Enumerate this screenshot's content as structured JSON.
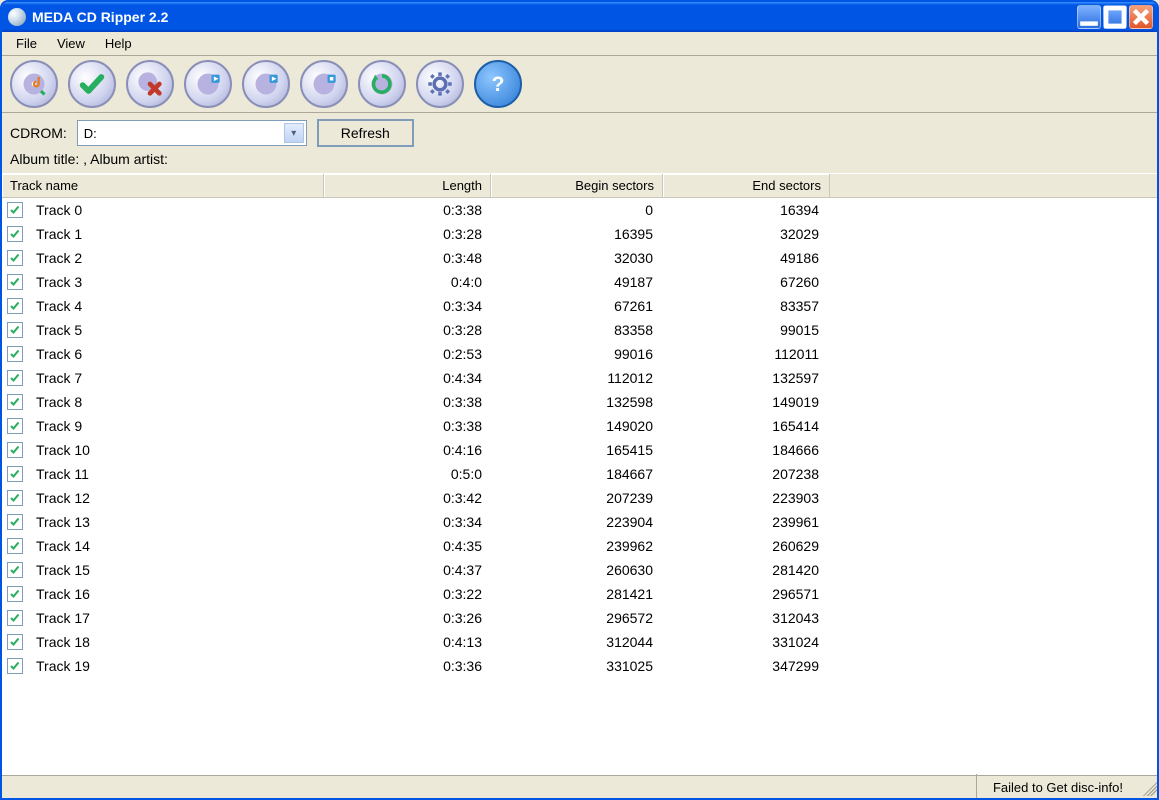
{
  "window": {
    "title": "MEDA CD Ripper 2.2"
  },
  "menubar": {
    "file": "File",
    "view": "View",
    "help": "Help"
  },
  "toolbar_icons": {
    "rip": "rip-icon",
    "check": "check-all-icon",
    "uncheck": "uncheck-icon",
    "prev": "prev-track-icon",
    "play": "play-icon",
    "stop": "stop-icon",
    "next": "next-track-icon",
    "settings": "settings-icon",
    "help": "help-icon"
  },
  "controls": {
    "cdrom_label": "CDROM:",
    "cdrom_value": "D:",
    "refresh": "Refresh"
  },
  "album": {
    "line": "Album title: , Album artist:"
  },
  "columns": {
    "name": "Track name",
    "length": "Length",
    "begin": "Begin sectors",
    "end": "End sectors"
  },
  "tracks": [
    {
      "checked": true,
      "name": "Track 0",
      "length": "0:3:38",
      "begin": "0",
      "end": "16394"
    },
    {
      "checked": true,
      "name": "Track 1",
      "length": "0:3:28",
      "begin": "16395",
      "end": "32029"
    },
    {
      "checked": true,
      "name": "Track 2",
      "length": "0:3:48",
      "begin": "32030",
      "end": "49186"
    },
    {
      "checked": true,
      "name": "Track 3",
      "length": "0:4:0",
      "begin": "49187",
      "end": "67260"
    },
    {
      "checked": true,
      "name": "Track 4",
      "length": "0:3:34",
      "begin": "67261",
      "end": "83357"
    },
    {
      "checked": true,
      "name": "Track 5",
      "length": "0:3:28",
      "begin": "83358",
      "end": "99015"
    },
    {
      "checked": true,
      "name": "Track 6",
      "length": "0:2:53",
      "begin": "99016",
      "end": "112011"
    },
    {
      "checked": true,
      "name": "Track 7",
      "length": "0:4:34",
      "begin": "112012",
      "end": "132597"
    },
    {
      "checked": true,
      "name": "Track 8",
      "length": "0:3:38",
      "begin": "132598",
      "end": "149019"
    },
    {
      "checked": true,
      "name": "Track 9",
      "length": "0:3:38",
      "begin": "149020",
      "end": "165414"
    },
    {
      "checked": true,
      "name": "Track 10",
      "length": "0:4:16",
      "begin": "165415",
      "end": "184666"
    },
    {
      "checked": true,
      "name": "Track 11",
      "length": "0:5:0",
      "begin": "184667",
      "end": "207238"
    },
    {
      "checked": true,
      "name": "Track 12",
      "length": "0:3:42",
      "begin": "207239",
      "end": "223903"
    },
    {
      "checked": true,
      "name": "Track 13",
      "length": "0:3:34",
      "begin": "223904",
      "end": "239961"
    },
    {
      "checked": true,
      "name": "Track 14",
      "length": "0:4:35",
      "begin": "239962",
      "end": "260629"
    },
    {
      "checked": true,
      "name": "Track 15",
      "length": "0:4:37",
      "begin": "260630",
      "end": "281420"
    },
    {
      "checked": true,
      "name": "Track 16",
      "length": "0:3:22",
      "begin": "281421",
      "end": "296571"
    },
    {
      "checked": true,
      "name": "Track 17",
      "length": "0:3:26",
      "begin": "296572",
      "end": "312043"
    },
    {
      "checked": true,
      "name": "Track 18",
      "length": "0:4:13",
      "begin": "312044",
      "end": "331024"
    },
    {
      "checked": true,
      "name": "Track 19",
      "length": "0:3:36",
      "begin": "331025",
      "end": "347299"
    }
  ],
  "status": {
    "message": "Failed to Get disc-info!"
  }
}
